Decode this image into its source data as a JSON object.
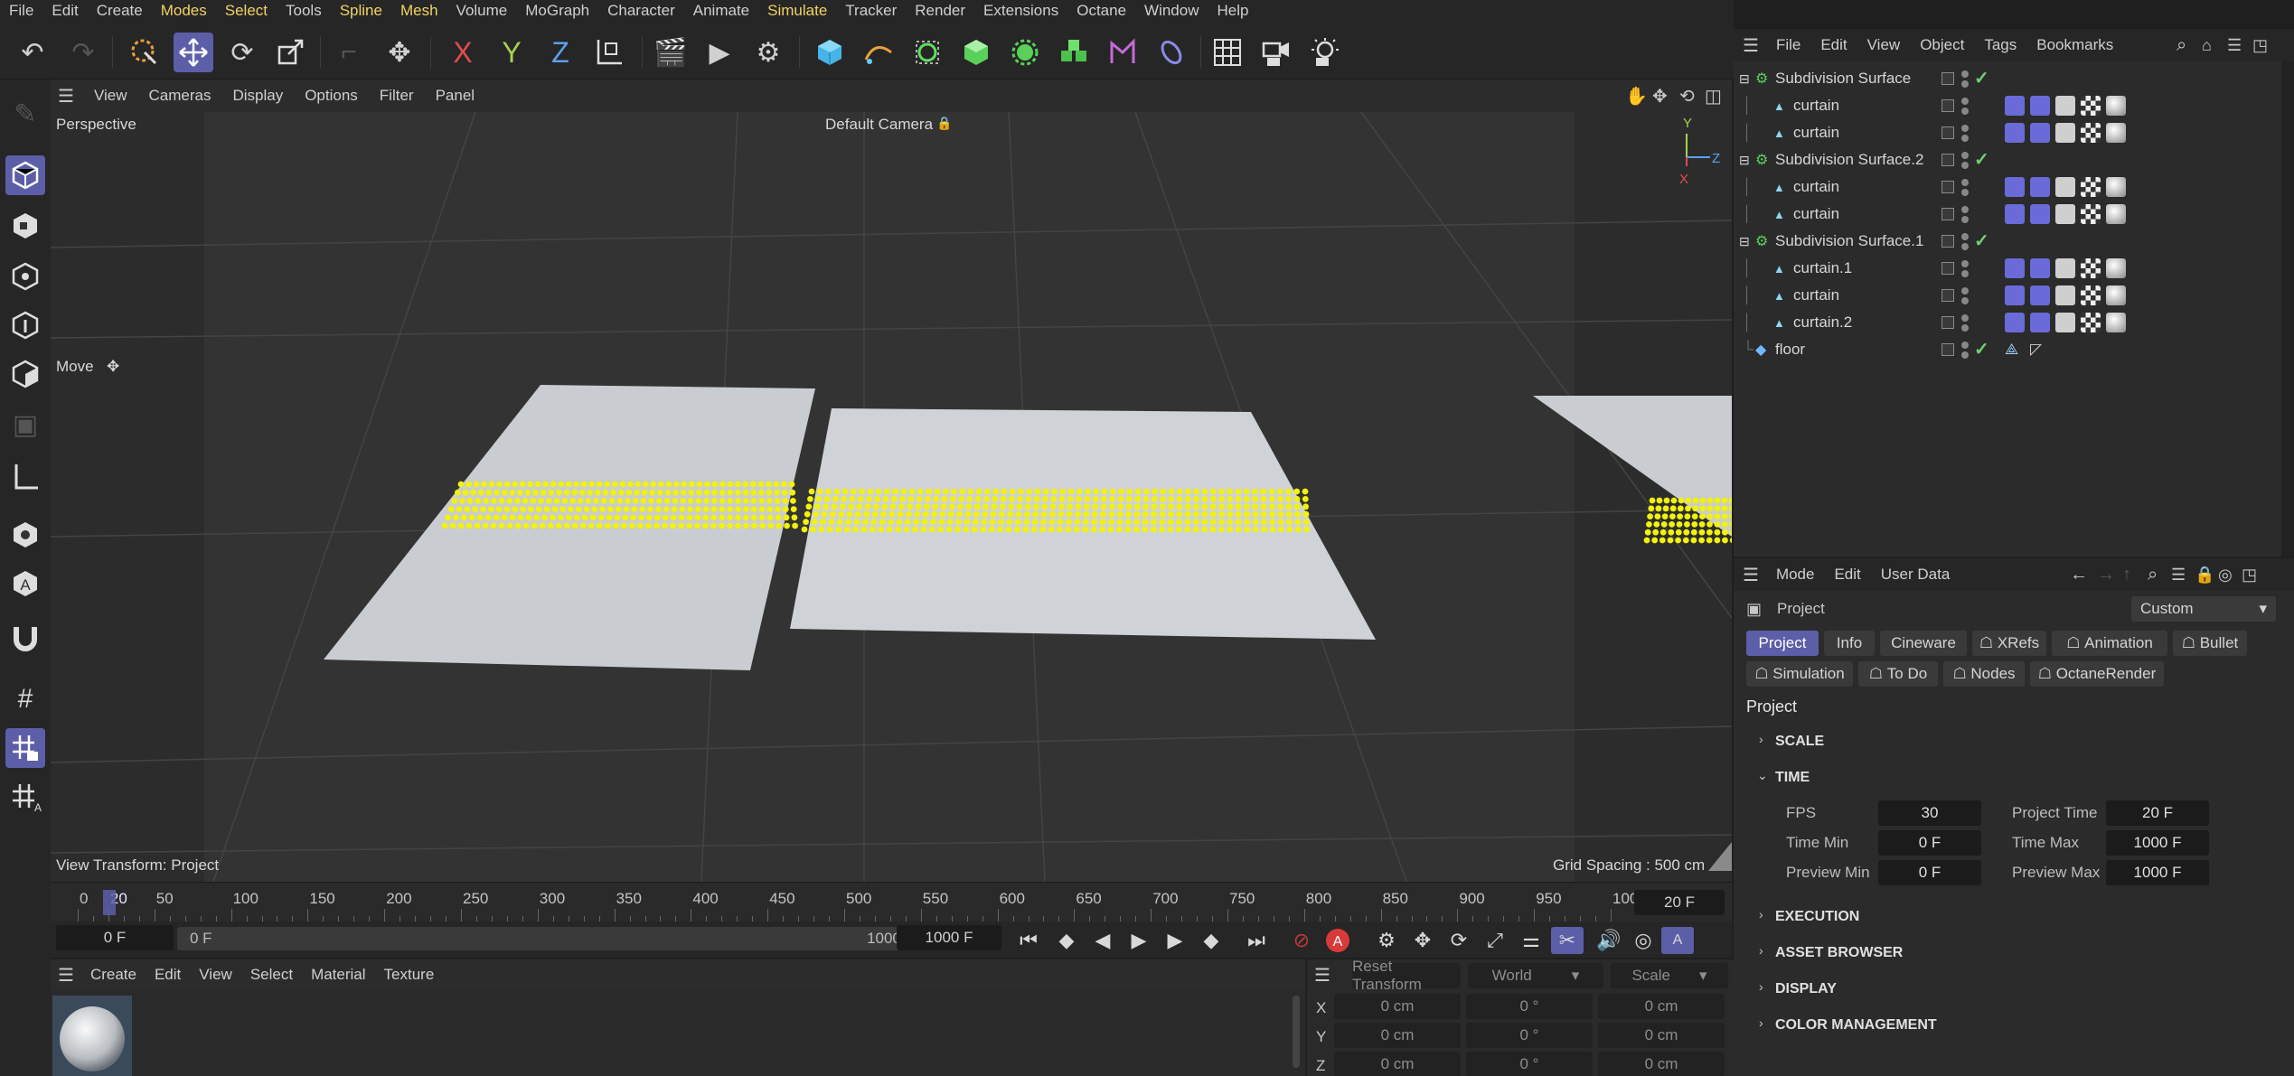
{
  "menu": [
    "File",
    "Edit",
    "Create",
    "Modes",
    "Select",
    "Tools",
    "Spline",
    "Mesh",
    "Volume",
    "MoGraph",
    "Character",
    "Animate",
    "Simulate",
    "Tracker",
    "Render",
    "Extensions",
    "Octane",
    "Window",
    "Help"
  ],
  "viewport": {
    "menu": [
      "View",
      "Cameras",
      "Display",
      "Options",
      "Filter",
      "Panel"
    ],
    "projection": "Perspective",
    "camera": "Default Camera",
    "tool": "Move",
    "view_transform": "View Transform: Project",
    "grid_spacing": "Grid Spacing : 500 cm",
    "axis": {
      "x": "X",
      "y": "Y",
      "z": "Z"
    }
  },
  "timeline": {
    "ticks": [
      "0",
      "20",
      "50",
      "100",
      "150",
      "200",
      "250",
      "300",
      "350",
      "400",
      "450",
      "500",
      "550",
      "600",
      "650",
      "700",
      "750",
      "800",
      "850",
      "900",
      "950",
      "1000"
    ],
    "current_frame": "20 F",
    "start": "0 F",
    "range_start": "0 F",
    "range_end": "1000 F",
    "end": "1000 F"
  },
  "material_manager": {
    "menu": [
      "Create",
      "Edit",
      "View",
      "Select",
      "Material",
      "Texture"
    ]
  },
  "coordinates": {
    "reset": "Reset Transform",
    "space": "World",
    "mode": "Scale",
    "rows": [
      {
        "axis": "X",
        "pos": "0 cm",
        "rot": "0 °",
        "size": "0 cm"
      },
      {
        "axis": "Y",
        "pos": "0 cm",
        "rot": "0 °",
        "size": "0 cm"
      },
      {
        "axis": "Z",
        "pos": "0 cm",
        "rot": "0 °",
        "size": "0 cm"
      }
    ]
  },
  "object_manager": {
    "menu": [
      "File",
      "Edit",
      "View",
      "Object",
      "Tags",
      "Bookmarks"
    ],
    "objects": [
      {
        "name": "Subdivision Surface",
        "level": 0,
        "kind": "subd",
        "check": true
      },
      {
        "name": "curtain",
        "level": 1,
        "kind": "cloth"
      },
      {
        "name": "curtain",
        "level": 1,
        "kind": "cloth"
      },
      {
        "name": "Subdivision Surface.2",
        "level": 0,
        "kind": "subd",
        "check": true
      },
      {
        "name": "curtain",
        "level": 1,
        "kind": "cloth"
      },
      {
        "name": "curtain",
        "level": 1,
        "kind": "cloth"
      },
      {
        "name": "Subdivision Surface.1",
        "level": 0,
        "kind": "subd",
        "check": true
      },
      {
        "name": "curtain.1",
        "level": 1,
        "kind": "cloth"
      },
      {
        "name": "curtain",
        "level": 1,
        "kind": "cloth"
      },
      {
        "name": "curtain.2",
        "level": 1,
        "kind": "cloth"
      },
      {
        "name": "floor",
        "level": 0,
        "kind": "floor",
        "check": true
      }
    ]
  },
  "attribute_manager": {
    "menu": [
      "Mode",
      "Edit",
      "User Data"
    ],
    "object_type": "Project",
    "preset": "Custom",
    "tabs_row1": [
      "Project",
      "Info",
      "Cineware",
      "XRefs",
      "Animation",
      "Bullet"
    ],
    "tabs_row2": [
      "Simulation",
      "To Do",
      "Nodes",
      "OctaneRender"
    ],
    "title": "Project",
    "sections": {
      "scale": "SCALE",
      "time": "TIME",
      "execution": "EXECUTION",
      "asset_browser": "ASSET BROWSER",
      "display": "DISPLAY",
      "color_management": "COLOR MANAGEMENT"
    },
    "time_fields": {
      "fps_label": "FPS",
      "fps": "30",
      "project_time_label": "Project Time",
      "project_time": "20 F",
      "time_min_label": "Time Min",
      "time_min": "0 F",
      "time_max_label": "Time Max",
      "time_max": "1000 F",
      "preview_min_label": "Preview Min",
      "preview_min": "0 F",
      "preview_max_label": "Preview Max",
      "preview_max": "1000 F"
    }
  },
  "colors": {
    "accent": "#5c5ea8",
    "highlight_menu": "#f1d264",
    "selection_points": "#f2f20a"
  }
}
